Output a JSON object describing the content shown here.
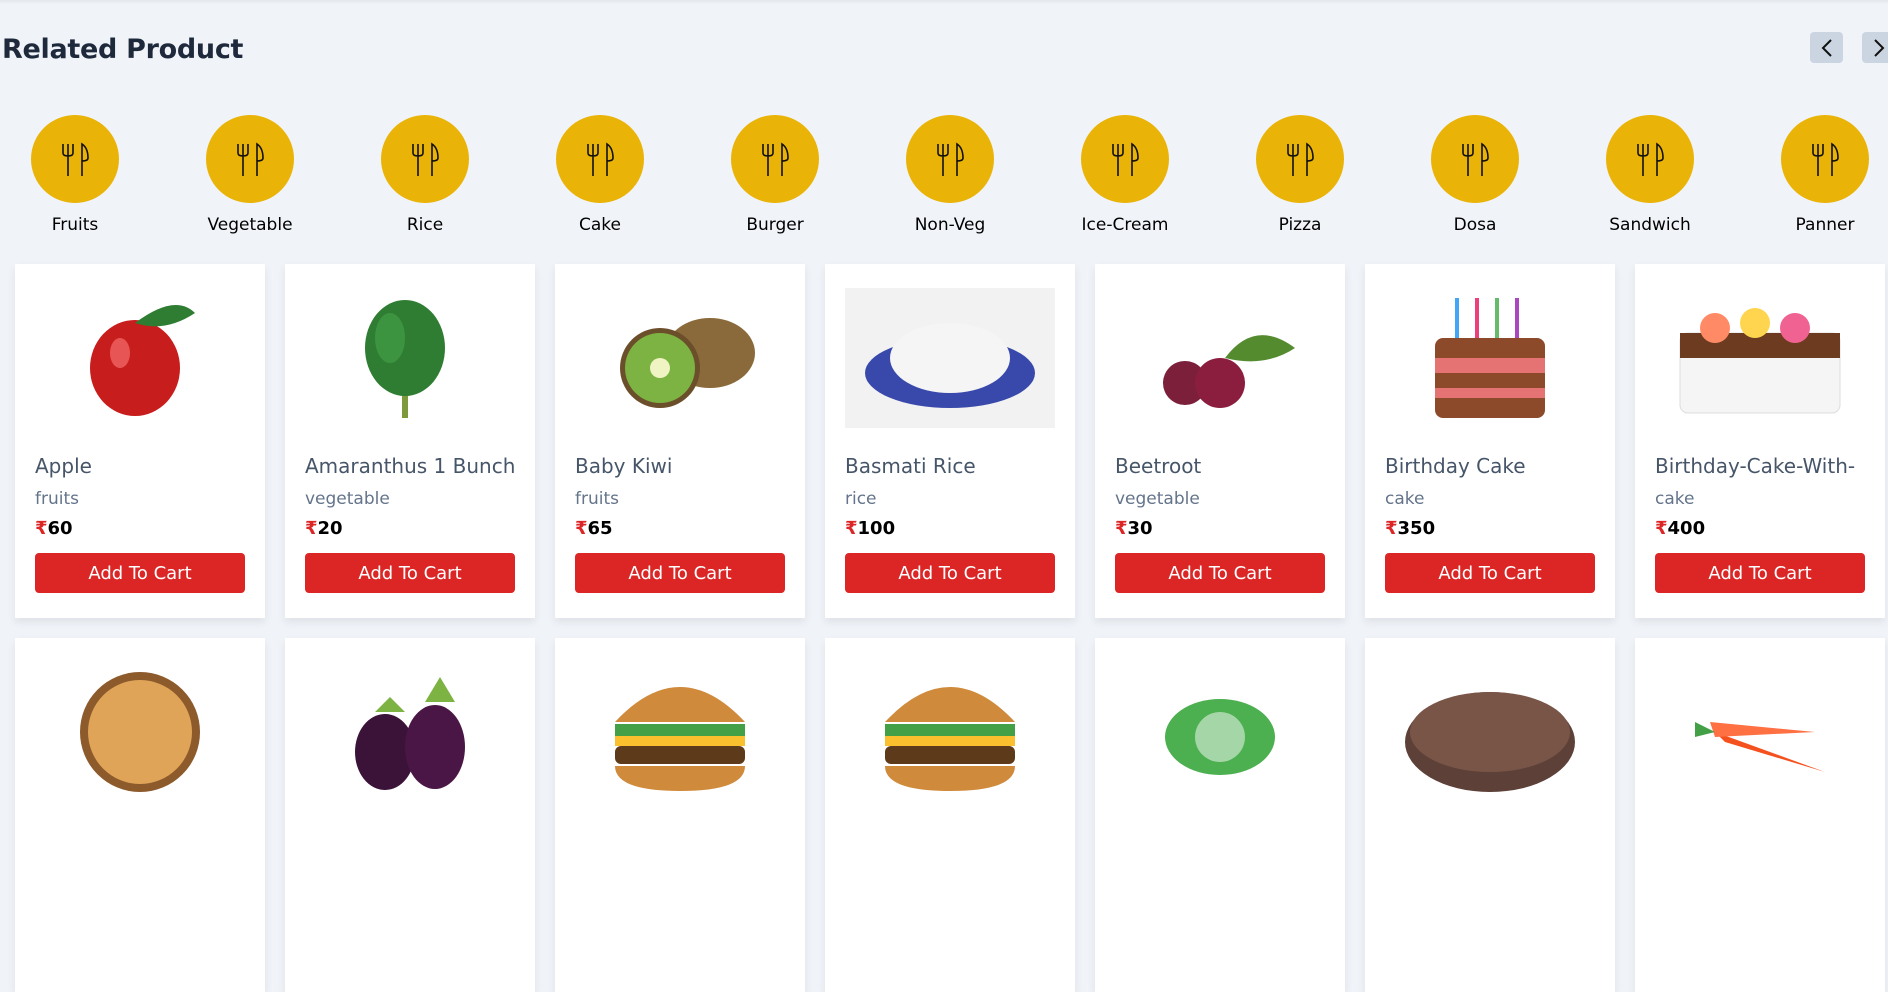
{
  "title": "Related Product",
  "nav": {
    "prev": "prev-arrow",
    "next": "next-arrow"
  },
  "colors": {
    "accent": "#eab308",
    "button": "#dc2626",
    "bg": "#f0f4f9"
  },
  "categories": [
    "Fruits",
    "Vegetable",
    "Rice",
    "Cake",
    "Burger",
    "Non-Veg",
    "Ice-Cream",
    "Pizza",
    "Dosa",
    "Sandwich",
    "Panner"
  ],
  "currency": "₹",
  "button_label": "Add To Cart",
  "products": [
    {
      "name": "Apple",
      "category": "fruits",
      "price": "60",
      "image": "apple"
    },
    {
      "name": "Amaranthus 1 Bunch",
      "category": "vegetable",
      "price": "20",
      "image": "greens"
    },
    {
      "name": "Baby Kiwi",
      "category": "fruits",
      "price": "65",
      "image": "kiwi"
    },
    {
      "name": "Basmati Rice",
      "category": "rice",
      "price": "100",
      "image": "rice"
    },
    {
      "name": "Beetroot",
      "category": "vegetable",
      "price": "30",
      "image": "beetroot"
    },
    {
      "name": "Birthday Cake",
      "category": "cake",
      "price": "350",
      "image": "cake"
    },
    {
      "name": "Birthday-Cake-With-",
      "category": "cake",
      "price": "400",
      "image": "cake2"
    }
  ],
  "products_row2": [
    {
      "image": "biryani"
    },
    {
      "image": "brinjal"
    },
    {
      "image": "burger"
    },
    {
      "image": "burger"
    },
    {
      "image": "cabbage"
    },
    {
      "image": "chocolate-cake"
    },
    {
      "image": "carrot"
    }
  ]
}
